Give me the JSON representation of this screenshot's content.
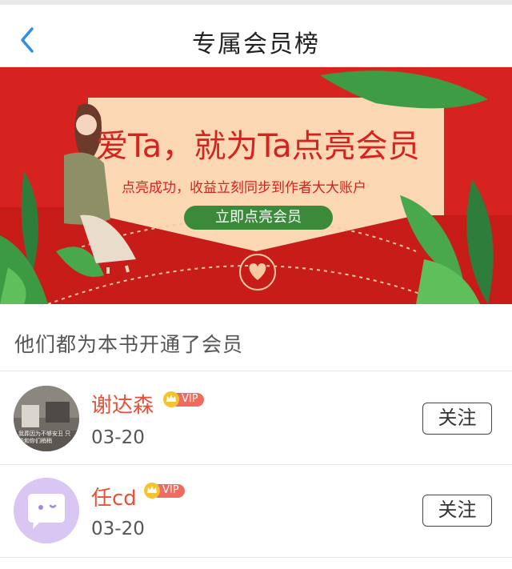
{
  "nav": {
    "title": "专属会员榜"
  },
  "banner": {
    "headline": "爱Ta，就为Ta点亮会员",
    "subline": "点亮成功，收益立刻同步到作者大大账户",
    "cta": "立即点亮会员"
  },
  "section": {
    "title": "他们都为本书开通了会员"
  },
  "members": [
    {
      "name": "谢达森",
      "badge": "VIP",
      "date": "03-20",
      "follow": "关注",
      "avatar_text": "我葬因为不够安丑 只能和你们稍稍"
    },
    {
      "name": "任cd",
      "badge": "VIP",
      "date": "03-20",
      "follow": "关注"
    }
  ],
  "colors": {
    "accent": "#e8503a",
    "banner_red": "#d6231f",
    "cta_green": "#3a8a3a",
    "avatar_purple": "#d9c6f3"
  }
}
